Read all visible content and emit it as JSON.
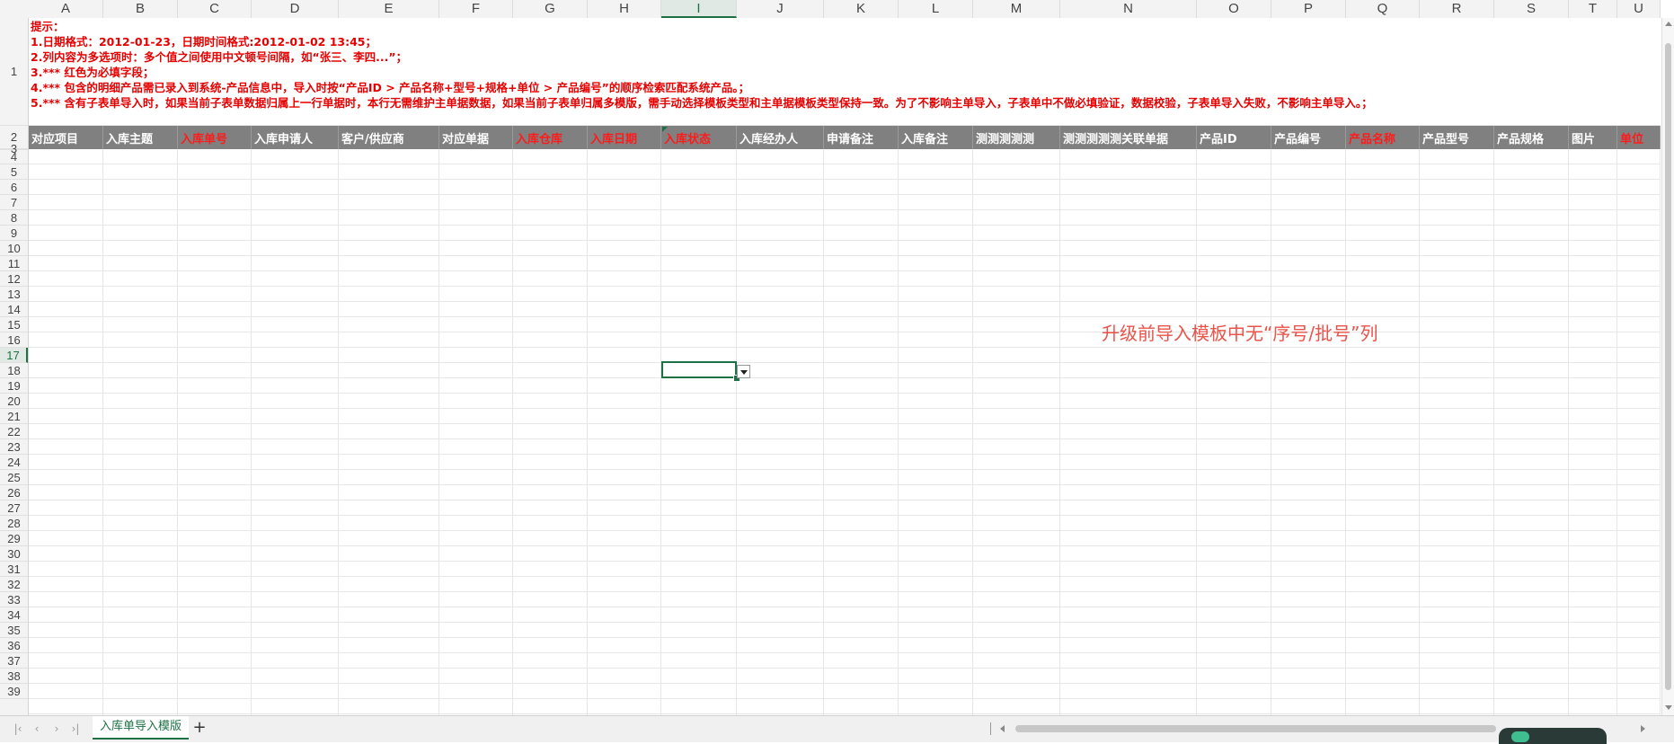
{
  "columns": [
    "A",
    "B",
    "C",
    "D",
    "E",
    "F",
    "G",
    "H",
    "I",
    "J",
    "K",
    "L",
    "M",
    "N",
    "O",
    "P",
    "Q",
    "R",
    "S",
    "T",
    "U"
  ],
  "active_column": "I",
  "rows": [
    "1",
    "2",
    "3",
    "4",
    "5",
    "6",
    "7",
    "8",
    "9",
    "10",
    "11",
    "12",
    "13",
    "14",
    "15",
    "16",
    "17",
    "18",
    "19",
    "20",
    "21",
    "22",
    "23",
    "24",
    "25",
    "26",
    "27",
    "28",
    "29",
    "30",
    "31",
    "32",
    "33",
    "34",
    "35",
    "36",
    "37",
    "38",
    "39"
  ],
  "active_row": "17",
  "notes": [
    "提示：",
    "1.日期格式：2012-01-23，日期时间格式:2012-01-02 13:45；",
    "2.列内容为多选项时：多个值之间使用中文顿号间隔，如“张三、李四...”；",
    "3.*** 红色为必填字段；",
    "4.*** 包含的明细产品需已录入到系统-产品信息中，导入时按“产品ID > 产品名称+型号+规格+单位 > 产品编号”的顺序检索匹配系统产品。；",
    "5.*** 含有子表单导入时，如果当前子表单数据归属上一行单据时，本行无需维护主单据数据，如果当前子表单归属多模版，需手动选择模板类型和主单据模板类型保持一致。为了不影响主单导入，子表单中不做必填验证，数据校验，子表单导入失败，不影响主单导入。；"
  ],
  "headers": [
    {
      "label": "对应项目",
      "required": false
    },
    {
      "label": "入库主题",
      "required": false
    },
    {
      "label": "入库单号",
      "required": true
    },
    {
      "label": "入库申请人",
      "required": false
    },
    {
      "label": "客户/供应商",
      "required": false
    },
    {
      "label": "对应单据",
      "required": false
    },
    {
      "label": "入库仓库",
      "required": true
    },
    {
      "label": "入库日期",
      "required": true
    },
    {
      "label": "入库状态",
      "required": true
    },
    {
      "label": "入库经办人",
      "required": false
    },
    {
      "label": "申请备注",
      "required": false
    },
    {
      "label": "入库备注",
      "required": false
    },
    {
      "label": "测测测测测",
      "required": false
    },
    {
      "label": "测测测测测关联单据",
      "required": false
    },
    {
      "label": "产品ID",
      "required": false
    },
    {
      "label": "产品编号",
      "required": false
    },
    {
      "label": "产品名称",
      "required": true
    },
    {
      "label": "产品型号",
      "required": false
    },
    {
      "label": "产品规格",
      "required": false
    },
    {
      "label": "图片",
      "required": false
    },
    {
      "label": "单位",
      "required": true
    }
  ],
  "annotation": "升级前导入模板中无“序号/批号”列",
  "sheet_tab": "入库单导入模版",
  "add_sheet_label": "+",
  "nav": {
    "first": "|‹",
    "prev": "‹",
    "next": "›",
    "last": "›|"
  },
  "colors": {
    "required": "#ff1a1a",
    "header_bg": "#808080",
    "accent": "#1e7145",
    "notes": "#e60000",
    "annotation": "#e8534a"
  }
}
